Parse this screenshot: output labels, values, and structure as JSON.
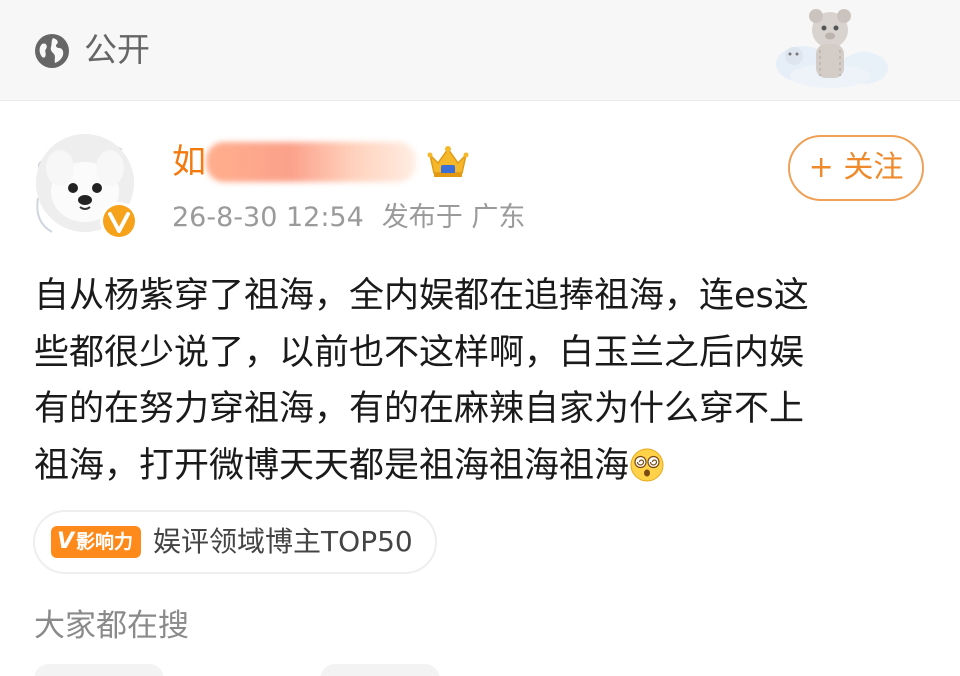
{
  "visibility": {
    "label": "公开",
    "icon": "globe-icon"
  },
  "author": {
    "name_visible": "如",
    "verified_icon": "verified-v-icon",
    "crown_icon": "crown-badge-icon",
    "post_time": "26-8-30 12:54",
    "location": "发布于 广东",
    "follow_label": "+ 关注"
  },
  "post": {
    "lines": [
      "自从杨紫穿了祖海，全内娱都在追捧祖海，连es这",
      "些都很少说了，以前也不这样啊，白玉兰之后内娱",
      "有的在努力穿祖海，有的在麻辣自家为什么穿不上",
      "祖海，打开微博天天都是祖海祖海祖海"
    ],
    "trailing_emoji": "dizzy-face-emoji"
  },
  "influence_tag": {
    "badge_v": "V",
    "badge_label": "影响力",
    "text": "娱评领域博主TOP50"
  },
  "search": {
    "heading": "大家都在搜"
  },
  "colors": {
    "accent_orange": "#f27a0f",
    "follow_border": "#f0a158",
    "badge_orange": "#ff8a1c",
    "meta_gray": "#9a9a9a",
    "body_text": "#1a1a1a"
  }
}
